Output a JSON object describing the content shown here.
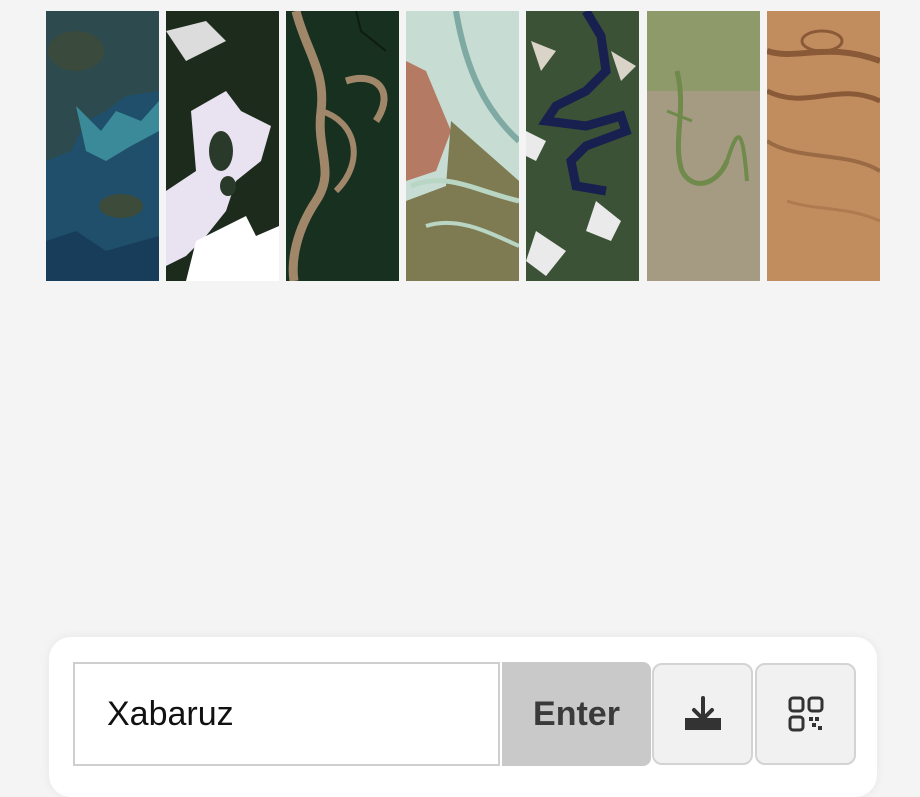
{
  "gallery": {
    "images": [
      {
        "icon": "satellite-coast-icon",
        "colors": [
          "#27424a",
          "#3b7a8c"
        ]
      },
      {
        "icon": "satellite-ice-icon",
        "colors": [
          "#1b2b1a",
          "#e9e4f2"
        ]
      },
      {
        "icon": "satellite-river-icon",
        "colors": [
          "#17301f",
          "#a1876a"
        ]
      },
      {
        "icon": "satellite-delta-icon",
        "colors": [
          "#b58569",
          "#c7dcd2"
        ]
      },
      {
        "icon": "satellite-mountain-lakes-icon",
        "colors": [
          "#3b5237",
          "#17204e"
        ]
      },
      {
        "icon": "satellite-steppe-icon",
        "colors": [
          "#a59b82",
          "#6f8a4a"
        ]
      },
      {
        "icon": "satellite-desert-icon",
        "colors": [
          "#c28d5e",
          "#8a5a38"
        ]
      }
    ]
  },
  "toolbar": {
    "input_value": "Xabaruz",
    "enter_label": "Enter",
    "download_icon": "download-icon",
    "qr_icon": "qr-code-icon"
  },
  "colors": {
    "background": "#f4f4f4",
    "enter_button": "#c9c9c9",
    "icon_color": "#333333"
  }
}
